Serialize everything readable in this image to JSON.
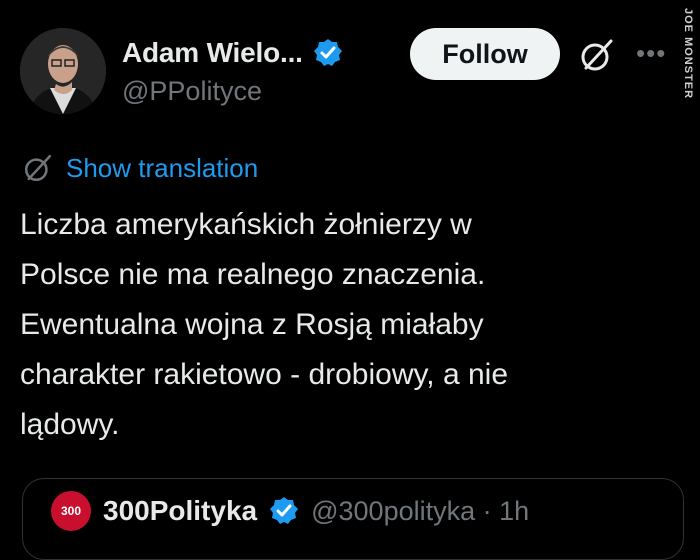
{
  "tweet": {
    "author_name": "Adam Wielo...",
    "author_handle": "@PPolityce",
    "verified_color": "#1d9bf0",
    "follow_label": "Follow",
    "show_translation_label": "Show translation",
    "body_lines": [
      "Liczba amerykańskich żołnierzy w",
      "Polsce nie ma realnego znaczenia.",
      "Ewentualna wojna z Rosją miałaby",
      "charakter rakietowo - drobiowy, a nie",
      "lądowy."
    ]
  },
  "quote": {
    "avatar_text": "300",
    "name": "300Polityka",
    "handle": "@300polityka · 1h"
  },
  "watermark": "JOE MONSTER",
  "icons": {
    "verified": "verified-badge-icon",
    "grok": "grok-icon",
    "more": "more-icon",
    "translate": "translate-icon"
  }
}
